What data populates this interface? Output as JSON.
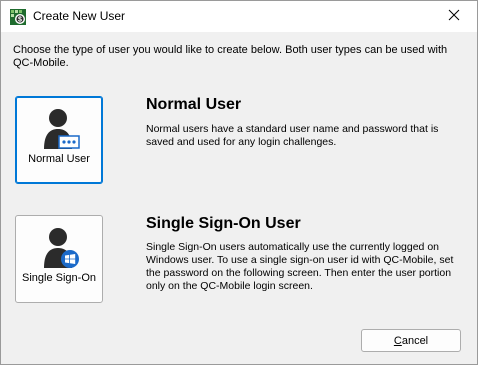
{
  "window": {
    "title": "Create New User",
    "app_icon": "qc-mobile-app-icon",
    "close_icon": "close-icon"
  },
  "intro_text": "Choose the type of user you would like to create below. Both user types can be used with QC-Mobile.",
  "options": [
    {
      "tile_label": "Normal User",
      "icon": "user-password-icon",
      "heading": "Normal User",
      "description": "Normal users have a standard user name and password that is saved and used for any login challenges.",
      "selected": true
    },
    {
      "tile_label": "Single Sign-On",
      "icon": "user-windows-icon",
      "heading": "Single Sign-On User",
      "description": "Single Sign-On users automatically use the currently logged on Windows user. To use a single sign-on user id with QC-Mobile, set the password on the following screen. Then enter the user portion only on the QC-Mobile login screen.",
      "selected": false
    }
  ],
  "buttons": {
    "cancel_first": "C",
    "cancel_rest": "ancel"
  },
  "colors": {
    "accent": "#0078d7",
    "dialog_bg": "#f0f0f0",
    "user_icon": "#2b2b2b",
    "windows_badge": "#1b6ac9"
  }
}
